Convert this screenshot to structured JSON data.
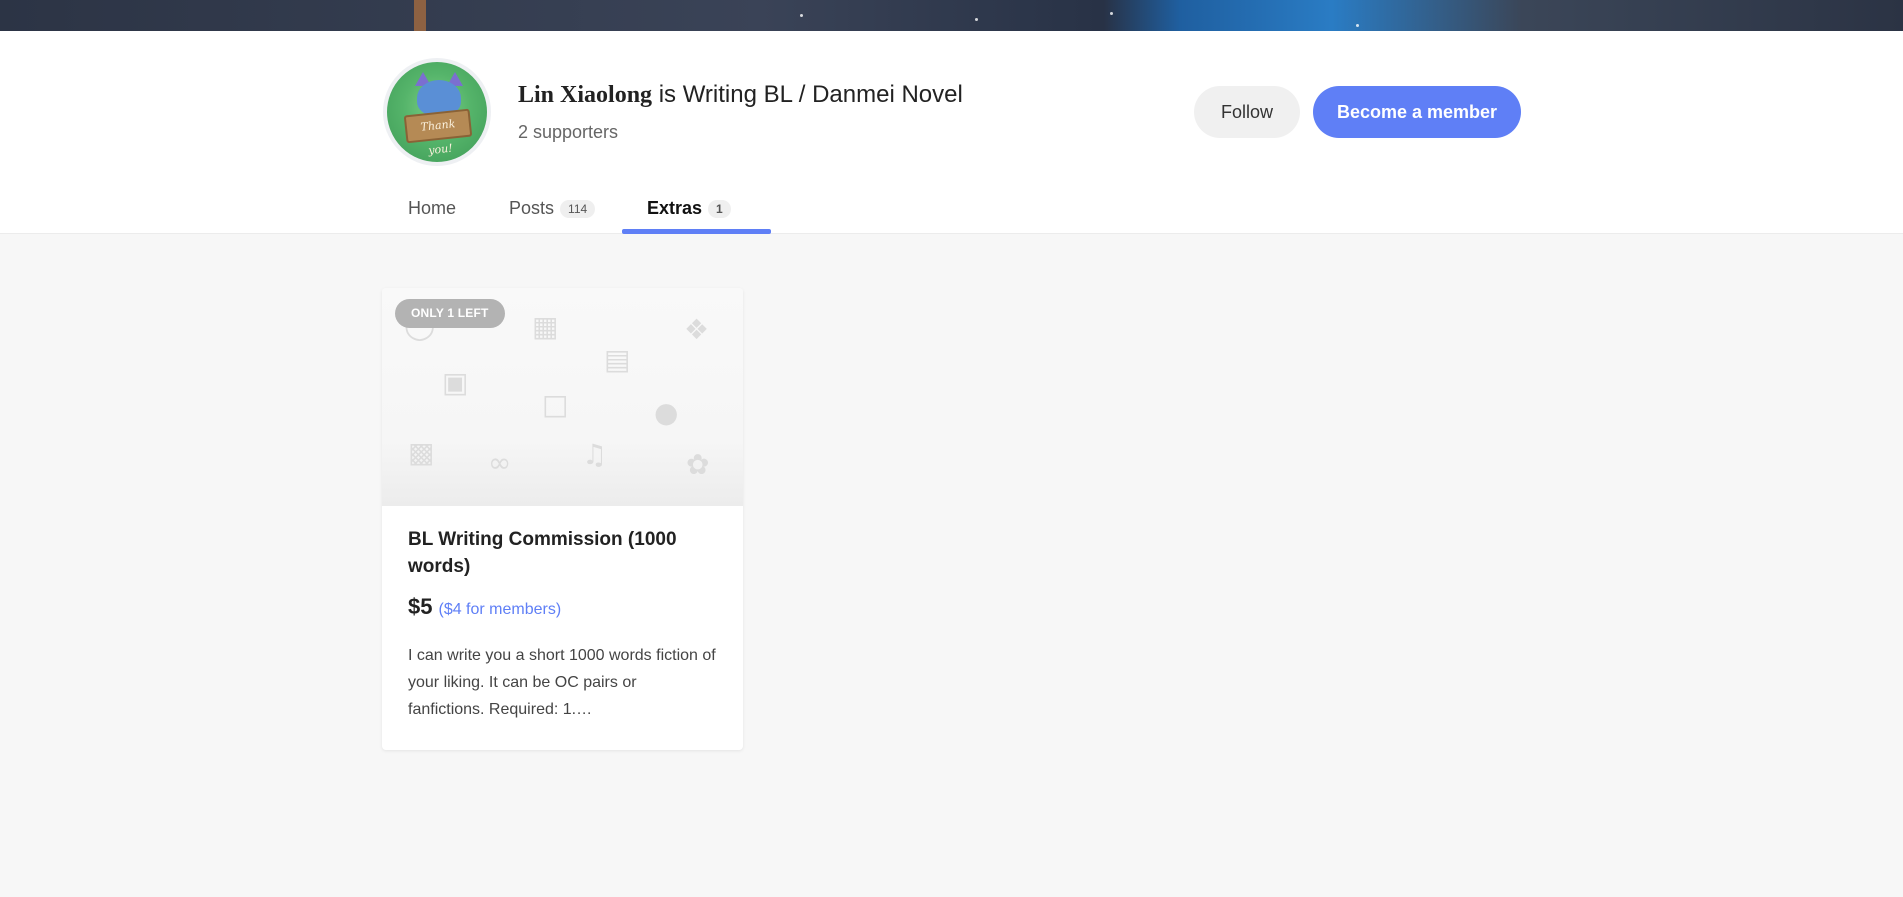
{
  "creator": {
    "name": "Lin Xiaolong",
    "tagline": " is Writing BL / Danmei Novel",
    "supporters": "2 supporters",
    "avatar_text": "Thank you!"
  },
  "actions": {
    "follow_label": "Follow",
    "member_label": "Become a member"
  },
  "tabs": [
    {
      "label": "Home",
      "count": ""
    },
    {
      "label": "Posts",
      "count": "114"
    },
    {
      "label": "Extras",
      "count": "1"
    }
  ],
  "active_tab": "Extras",
  "extra": {
    "badge": "ONLY 1 LEFT",
    "title": "BL Writing Commission (1000 words)",
    "price": "$5",
    "member_price": "($4 for members)",
    "description": "I can write you a short 1000 words fiction of your liking. It can be OC pairs or fanfictions. Required: 1.…",
    "icons": [
      "chat-icon",
      "calendar-icon",
      "film-icon",
      "gamepad-icon",
      "document-icon",
      "gift-icon",
      "microphone-icon",
      "lock-icon",
      "link-icon",
      "music-icon",
      "palette-icon"
    ]
  },
  "colors": {
    "accent": "#5f7ff6",
    "badge": "#b3b3b3",
    "page_bg": "#f7f7f7"
  }
}
